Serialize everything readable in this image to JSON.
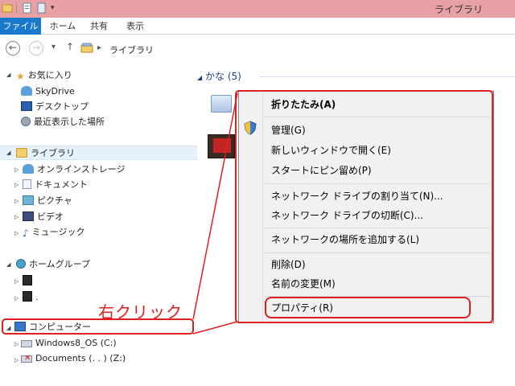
{
  "window": {
    "title": "ライブラリ"
  },
  "ribbon": {
    "tabs": [
      "ファイル",
      "ホーム",
      "共有",
      "表示"
    ]
  },
  "address": {
    "back": "←",
    "forward": "→",
    "dropdown": "▾",
    "up": "↑",
    "separator": "▸",
    "path": "ライブラリ"
  },
  "tree": {
    "favorites": {
      "label": "お気に入り",
      "items": [
        "SkyDrive",
        "デスクトップ",
        "最近表示した場所"
      ]
    },
    "libraries": {
      "label": "ライブラリ",
      "items": [
        "オンラインストレージ",
        "ドキュメント",
        "ピクチャ",
        "ビデオ",
        "ミュージック"
      ]
    },
    "homegroup": {
      "label": "ホームグループ",
      "users": [
        "",
        "."
      ]
    },
    "computer": {
      "label": "コンピューター",
      "drives": [
        "Windows8_OS (C:)",
        "Documents (.  .          ) (Z:)"
      ]
    }
  },
  "content": {
    "group_header": "かな (5)"
  },
  "context_menu": {
    "items": [
      "折りたたみ(A)",
      "管理(G)",
      "新しいウィンドウで開く(E)",
      "スタートにピン留め(P)",
      "ネットワーク ドライブの割り当て(N)...",
      "ネットワーク ドライブの切断(C)...",
      "ネットワークの場所を追加する(L)",
      "削除(D)",
      "名前の変更(M)",
      "プロパティ(R)"
    ]
  },
  "annotation": {
    "label": "右クリック",
    "color": "#e02020"
  },
  "colors": {
    "titlebar": "#e7a0a3",
    "file_tab": "#1979ca",
    "group_header": "#1e3d8a"
  }
}
